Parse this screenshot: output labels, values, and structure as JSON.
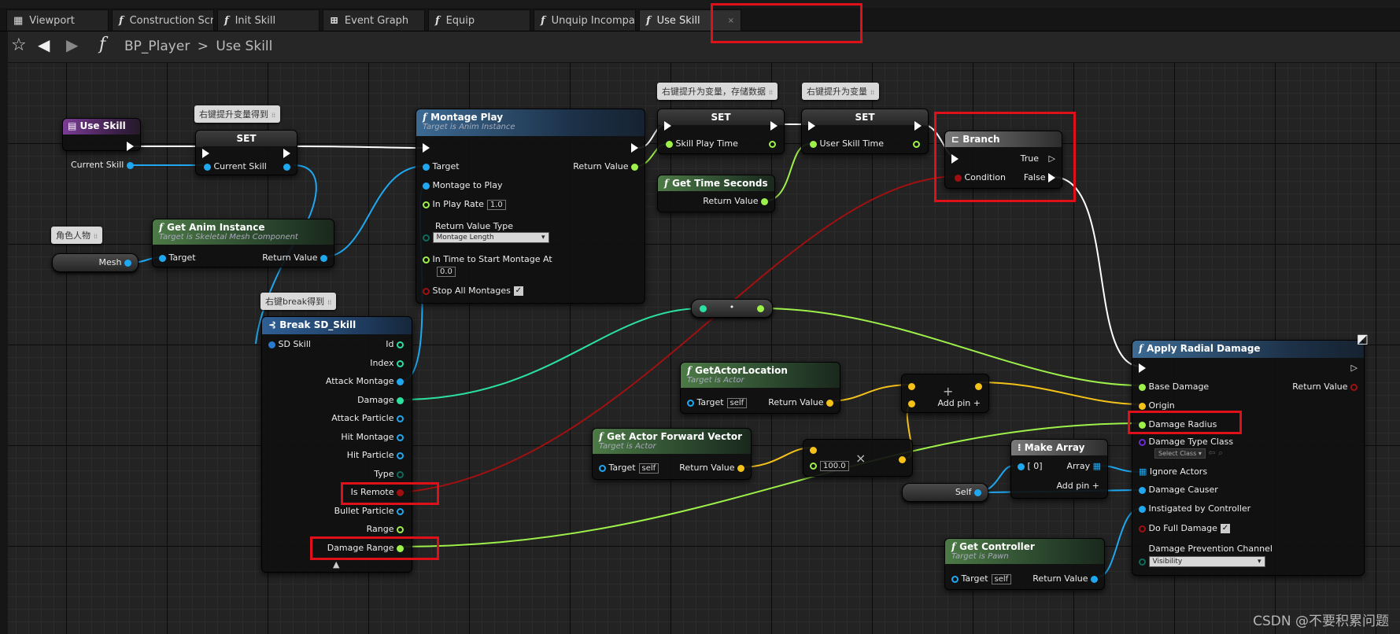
{
  "colors": {
    "exec": "#ffffff",
    "object": "#1fa8f0",
    "float": "#9ef04a",
    "bool": "#a01010",
    "vector": "#f5c21a",
    "class": "#6a2cd0",
    "byte": "#0e6a5a",
    "int": "#2ce0a0",
    "struct": "#2a7ad0",
    "highlight": "#e0101a"
  },
  "tabs": [
    {
      "icon": "grid-icon",
      "label": "Viewport"
    },
    {
      "icon": "function-icon",
      "label": "Construction Scrip"
    },
    {
      "icon": "function-icon",
      "label": "Init Skill"
    },
    {
      "icon": "graph-icon",
      "label": "Event Graph"
    },
    {
      "icon": "function-icon",
      "label": "Equip"
    },
    {
      "icon": "function-icon",
      "label": "Unquip Incompatib"
    },
    {
      "icon": "function-icon",
      "label": "Use Skill",
      "close": "×",
      "active": true
    }
  ],
  "breadcrumb": {
    "blueprint": "BP_Player",
    "separator": ">",
    "graph": "Use Skill"
  },
  "comments": {
    "c1": "右键提升变量得到",
    "c2": "右键提升为变量，存储数据",
    "c3": "右键提升为变量",
    "c4": "角色人物",
    "c5": "右键break得到",
    "marker": "⁞⁞"
  },
  "nodes": {
    "use_skill": {
      "title": "Use Skill",
      "output": "Current Skill"
    },
    "set1": {
      "title": "SET",
      "input": "Current Skill"
    },
    "montage_play": {
      "title": "Montage Play",
      "subtitle": "Target is Anim Instance",
      "target": "Target",
      "montage": "Montage to Play",
      "rate_label": "In Play Rate",
      "rate": "1.0",
      "rvt_label": "Return Value Type",
      "rvt": "Montage Length",
      "start_label": "In Time to Start Montage At",
      "start": "0.0",
      "stop_label": "Stop All Montages",
      "return": "Return Value"
    },
    "set2": {
      "title": "SET",
      "pin": "Skill Play Time"
    },
    "set3": {
      "title": "SET",
      "pin": "User Skill Time"
    },
    "get_time": {
      "title": "Get Time Seconds",
      "return": "Return Value"
    },
    "branch": {
      "title": "Branch",
      "condition": "Condition",
      "true": "True",
      "false": "False"
    },
    "mesh": {
      "label": "Mesh"
    },
    "anim_inst": {
      "title": "Get Anim Instance",
      "subtitle": "Target is Skeletal Mesh Component",
      "target": "Target",
      "return": "Return Value"
    },
    "break_skill": {
      "title": "Break SD_Skill",
      "input": "SD Skill",
      "pins": [
        "Id",
        "Index",
        "Attack Montage",
        "Damage",
        "Attack Particle",
        "Hit Montage",
        "Hit Particle",
        "Type",
        "Is Remote",
        "Bullet Particle",
        "Range",
        "Damage Range"
      ]
    },
    "reroute": {
      "label": "•"
    },
    "actor_loc": {
      "title": "GetActorLocation",
      "subtitle": "Target is Actor",
      "target": "Target",
      "self": "self",
      "return": "Return Value"
    },
    "add": {
      "symbol": "+",
      "label": "Add pin",
      "plus": "+"
    },
    "fwd": {
      "title": "Get Actor Forward Vector",
      "subtitle": "Target is Actor",
      "target": "Target",
      "self": "self",
      "return": "Return Value"
    },
    "mult": {
      "symbol": "×",
      "value": "100.0"
    },
    "self_var": {
      "label": "Self"
    },
    "make_array": {
      "title": "Make Array",
      "item": "[ 0]",
      "array": "Array",
      "add": "Add pin",
      "plus": "+"
    },
    "get_ctrl": {
      "title": "Get Controller",
      "subtitle": "Target is Pawn",
      "target": "Target",
      "self": "self",
      "return": "Return Value"
    },
    "radial": {
      "title": "Apply Radial Damage",
      "base": "Base Damage",
      "return": "Return Value",
      "origin": "Origin",
      "radius": "Damage Radius",
      "dtc": "Damage Type Class",
      "select": "Select Class",
      "ignore": "Ignore Actors",
      "causer": "Damage Causer",
      "instig": "Instigated by Controller",
      "full": "Do Full Damage",
      "channel_label": "Damage Prevention Channel",
      "channel": "Visibility"
    }
  },
  "watermark": "CSDN @不要积累问题"
}
